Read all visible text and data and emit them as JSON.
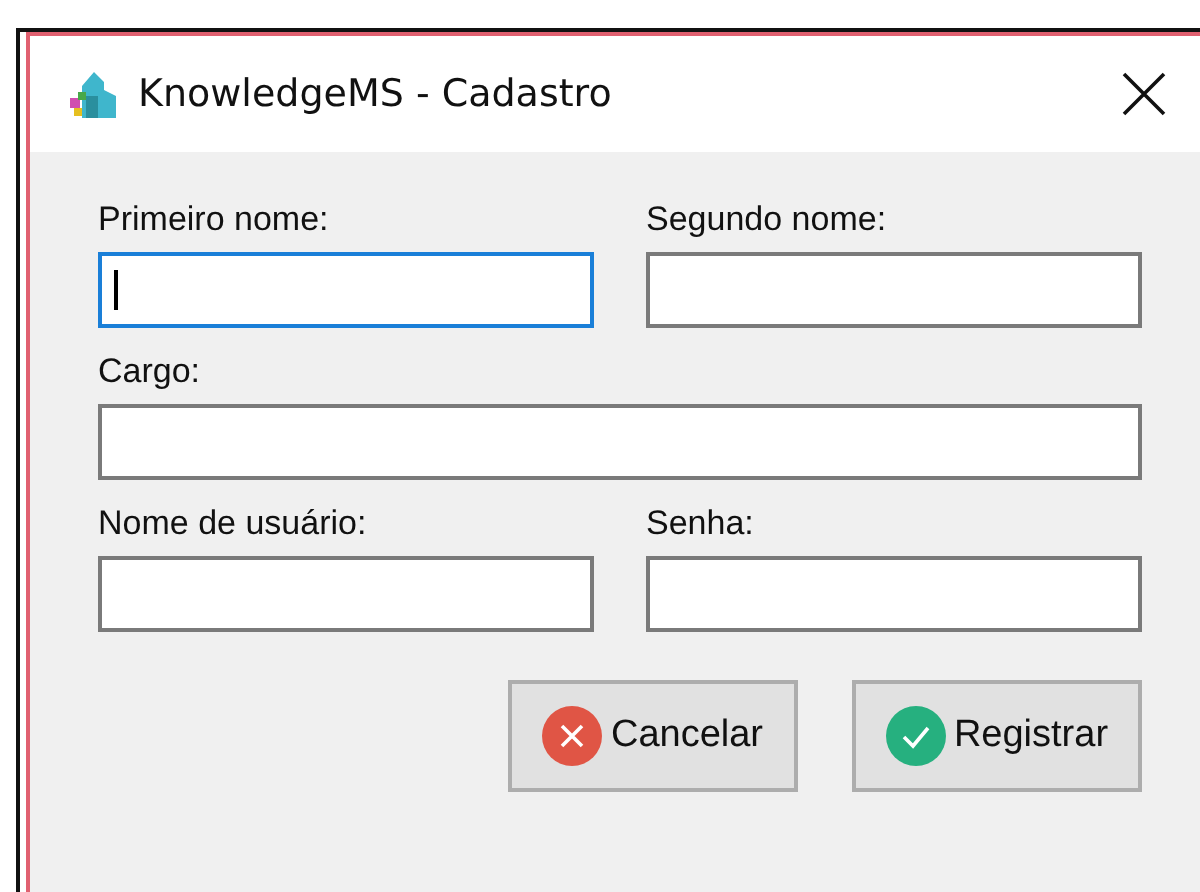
{
  "window": {
    "title": "KnowledgeMS - Cadastro"
  },
  "fields": [
    {
      "label": "Primeiro nome:",
      "kind": "half",
      "focused": true
    },
    {
      "label": "Segundo nome:",
      "kind": "half",
      "focused": false
    },
    {
      "label": "Cargo:",
      "kind": "full",
      "focused": false
    },
    {
      "label": "Nome de usuário:",
      "kind": "half",
      "focused": false
    },
    {
      "label": "Senha:",
      "kind": "half",
      "focused": false
    }
  ],
  "buttons": [
    {
      "label": "Cancelar",
      "kind": "cancel"
    },
    {
      "label": "Registrar",
      "kind": "confirm"
    }
  ]
}
